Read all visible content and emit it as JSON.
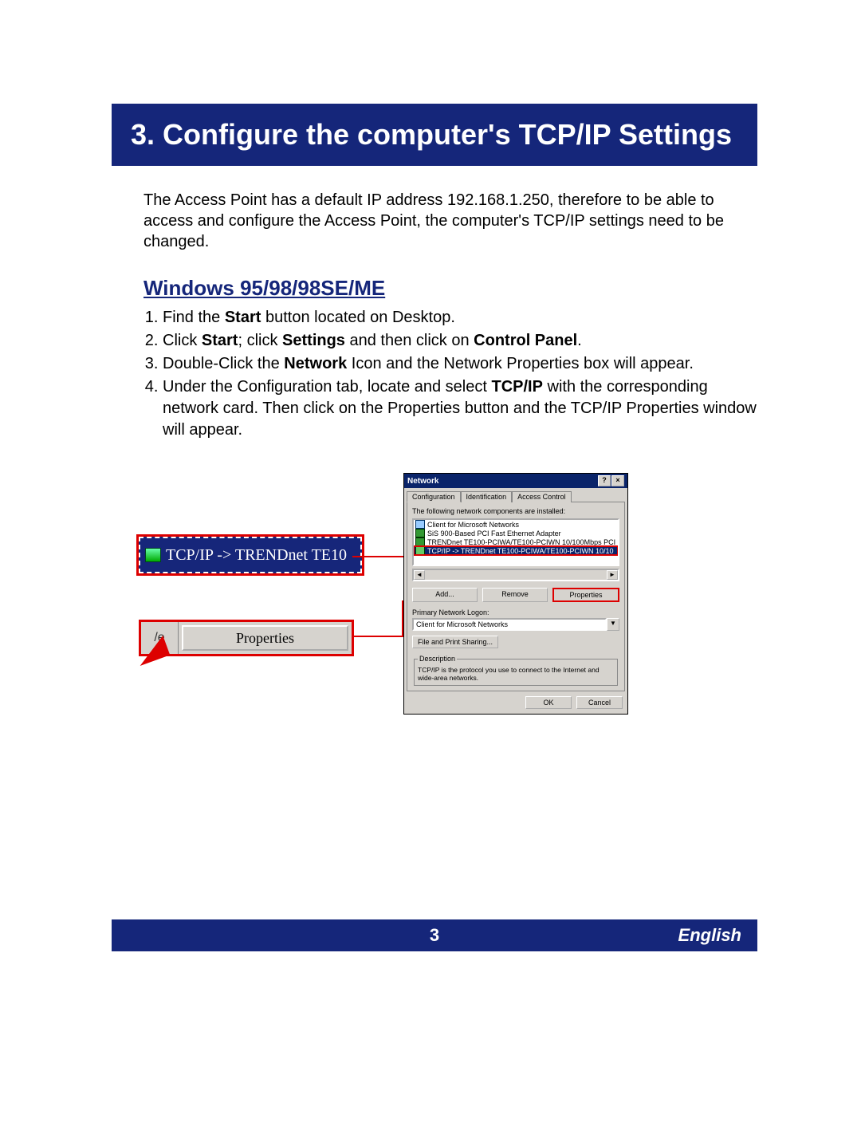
{
  "title": "3. Configure the computer's TCP/IP Settings",
  "intro": "The Access Point has a default IP address 192.168.1.250, therefore to be able to access and configure the Access Point, the computer's TCP/IP settings need to be changed.",
  "section_heading": "Windows 95/98/98SE/ME",
  "steps": {
    "s1_a": "Find the ",
    "s1_b": "Start",
    "s1_c": " button located on Desktop.",
    "s2_a": "Click ",
    "s2_b": "Start",
    "s2_c": "; click ",
    "s2_d": "Settings",
    "s2_e": " and then click on ",
    "s2_f": "Control Panel",
    "s2_g": ".",
    "s3_a": "Double-Click the ",
    "s3_b": "Network",
    "s3_c": " Icon and the Network Properties box will appear.",
    "s4_a": "Under the Configuration tab, locate and select ",
    "s4_b": "TCP/IP",
    "s4_c": " with the corresponding network card. Then click on the Properties button and the TCP/IP Properties window will appear."
  },
  "callouts": {
    "tcpip_zoom": "TCP/IP -> TRENDnet TE10",
    "properties_left_text": "/e",
    "properties_button": "Properties"
  },
  "dialog": {
    "title": "Network",
    "help_btn": "?",
    "close_btn": "×",
    "tabs": [
      "Configuration",
      "Identification",
      "Access Control"
    ],
    "list_label": "The following network components are installed:",
    "list_items": [
      "Client for Microsoft Networks",
      "SiS 900-Based PCI Fast Ethernet Adapter",
      "TRENDnet TE100-PCIWA/TE100-PCIWN 10/100Mbps PCI",
      "TCP/IP -> TRENDnet TE100-PCIWA/TE100-PCIWN 10/10"
    ],
    "scroll_left": "◄",
    "scroll_right": "►",
    "buttons": {
      "add": "Add...",
      "remove": "Remove",
      "properties": "Properties"
    },
    "logon_label": "Primary Network Logon:",
    "logon_value": "Client for Microsoft Networks",
    "drop_glyph": "▼",
    "file_print": "File and Print Sharing...",
    "desc_legend": "Description",
    "desc_text": "TCP/IP is the protocol you use to connect to the Internet and wide-area networks.",
    "ok": "OK",
    "cancel": "Cancel"
  },
  "footer": {
    "page": "3",
    "language": "English"
  }
}
